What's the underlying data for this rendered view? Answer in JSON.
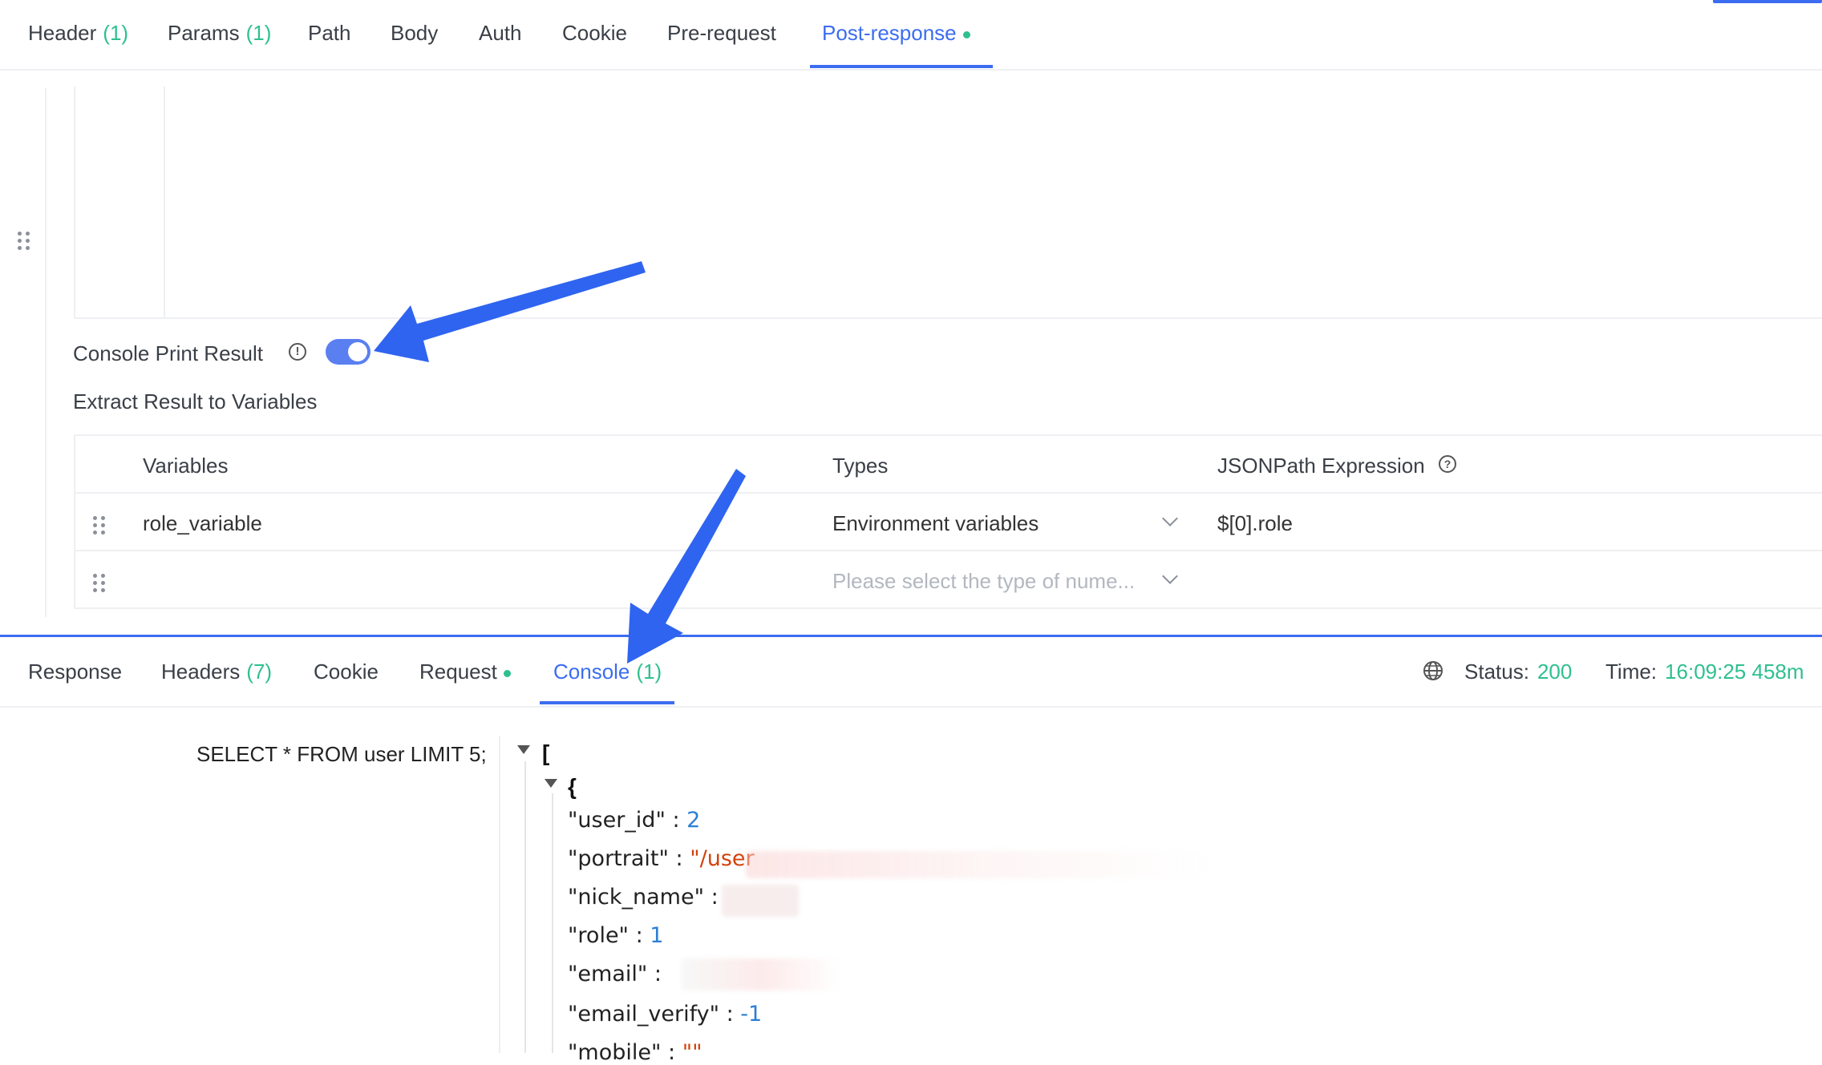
{
  "request_tabs": [
    {
      "label": "Header",
      "count": "(1)"
    },
    {
      "label": "Params",
      "count": "(1)"
    },
    {
      "label": "Path"
    },
    {
      "label": "Body"
    },
    {
      "label": "Auth"
    },
    {
      "label": "Cookie"
    },
    {
      "label": "Pre-request"
    },
    {
      "label": "Post-response",
      "active": true,
      "has_dot": true
    }
  ],
  "post_response": {
    "console_print_label": "Console Print Result",
    "console_print_enabled": true,
    "extract_label": "Extract Result to Variables",
    "table": {
      "headers": {
        "variables": "Variables",
        "types": "Types",
        "jsonpath": "JSONPath Expression"
      },
      "rows": [
        {
          "variable": "role_variable",
          "type": "Environment variables",
          "expression": "$[0].role"
        },
        {
          "variable": "",
          "type_placeholder": "Please select the type of nume...",
          "expression": ""
        }
      ]
    }
  },
  "response_tabs": [
    {
      "label": "Response"
    },
    {
      "label": "Headers",
      "count": "(7)"
    },
    {
      "label": "Cookie"
    },
    {
      "label": "Request",
      "has_dot": true
    },
    {
      "label": "Console",
      "count": "(1)",
      "active": true
    }
  ],
  "status_bar": {
    "status_label": "Status:",
    "status_value": "200",
    "time_label": "Time:",
    "time_value": "16:09:25 458m"
  },
  "console": {
    "sql": "SELECT * FROM user LIMIT 5;",
    "open_array": "[",
    "open_object": "{",
    "fields": [
      {
        "key": "\"user_id\"",
        "sep": " : ",
        "value": "2",
        "kind": "num"
      },
      {
        "key": "\"portrait\"",
        "sep": " : ",
        "value": "\"/user",
        "kind": "str"
      },
      {
        "key": "\"nick_name\"",
        "sep": " : ",
        "value": "",
        "kind": "str"
      },
      {
        "key": "\"role\"",
        "sep": " : ",
        "value": "1",
        "kind": "num"
      },
      {
        "key": "\"email\"",
        "sep": " : ",
        "value": "",
        "kind": "str"
      },
      {
        "key": "\"email_verify\"",
        "sep": " : ",
        "value": "-1",
        "kind": "num"
      },
      {
        "key": "\"mobile\"",
        "sep": " : ",
        "value": "\"\"",
        "kind": "str"
      }
    ]
  },
  "colors": {
    "accent": "#3c6df0",
    "success": "#2fc08e",
    "arrow": "#2f64f0"
  }
}
